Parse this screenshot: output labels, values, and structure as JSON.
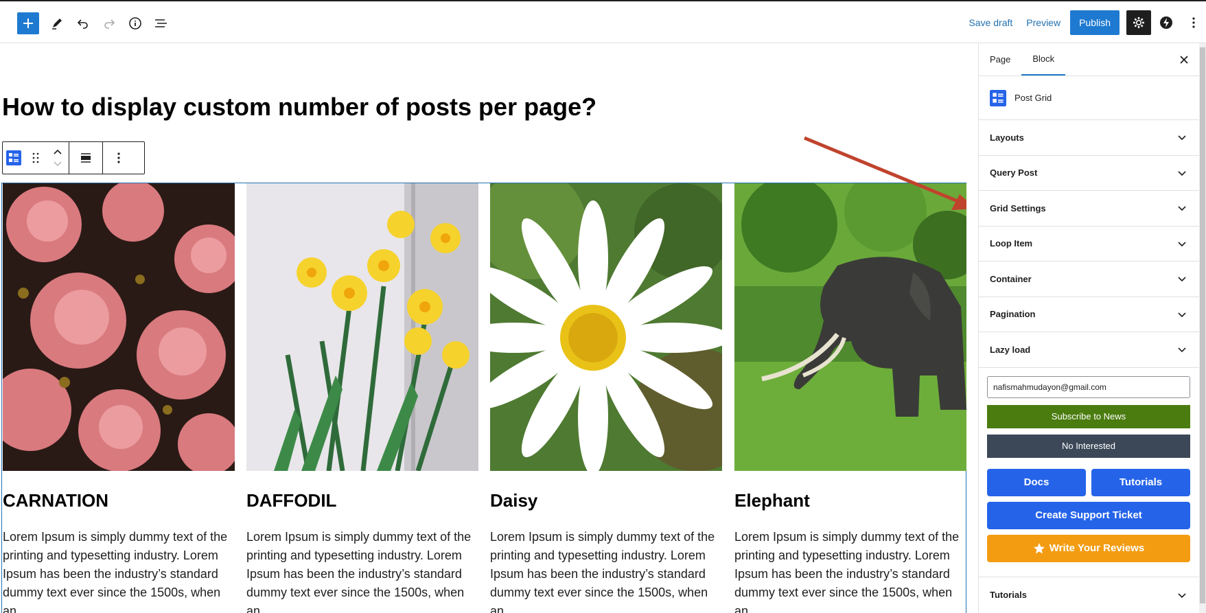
{
  "toolbar": {
    "save_draft": "Save draft",
    "preview": "Preview",
    "publish": "Publish"
  },
  "post": {
    "title": "How to display custom number of posts per page?"
  },
  "grid": {
    "items": [
      {
        "title": "CARNATION",
        "text": "Lorem Ipsum is simply dummy text of the printing and typesetting industry. Lorem Ipsum has been the industry’s standard dummy text ever since the 1500s, when an"
      },
      {
        "title": "DAFFODIL",
        "text": "Lorem Ipsum is simply dummy text of the printing and typesetting industry. Lorem Ipsum has been the industry’s standard dummy text ever since the 1500s, when an"
      },
      {
        "title": "Daisy",
        "text": "Lorem Ipsum is simply dummy text of the printing and typesetting industry. Lorem Ipsum has been the industry’s standard dummy text ever since the 1500s, when an"
      },
      {
        "title": "Elephant",
        "text": "Lorem Ipsum is simply dummy text of the printing and typesetting industry. Lorem Ipsum has been the industry’s standard dummy text ever since the 1500s, when an"
      }
    ]
  },
  "sidebar": {
    "tabs": [
      {
        "label": "Page"
      },
      {
        "label": "Block"
      }
    ],
    "block_name": "Post Grid",
    "panels": [
      {
        "label": "Layouts"
      },
      {
        "label": "Query Post"
      },
      {
        "label": "Grid Settings"
      },
      {
        "label": "Loop Item"
      },
      {
        "label": "Container"
      },
      {
        "label": "Pagination"
      },
      {
        "label": "Lazy load"
      }
    ],
    "email_value": "nafismahmudayon@gmail.com",
    "subscribe": "Subscribe to News",
    "not_interested": "No Interested",
    "docs": "Docs",
    "tutorials_btn": "Tutorials",
    "support": "Create Support Ticket",
    "reviews": "Write Your Reviews",
    "tutorials_panel": "Tutorials"
  },
  "colors": {
    "accent": "#1e7ad1",
    "arrow": "#c0432d",
    "subscribe": "#4a7c0f",
    "blue_button": "#2563e9",
    "orange_button": "#f39c12"
  }
}
